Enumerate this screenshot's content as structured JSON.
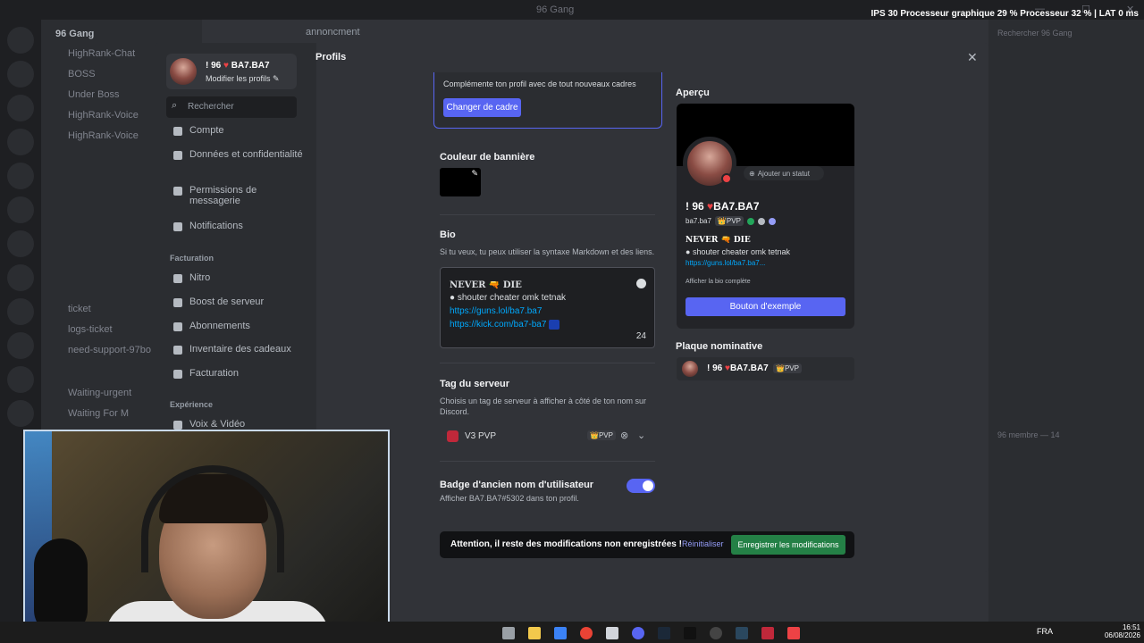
{
  "window": {
    "title": "96 Gang"
  },
  "hud": {
    "ips_label": "IPS",
    "ips_value": "30",
    "gpu_label": "Processeur graphique",
    "gpu_pct": "29 %",
    "cpu_label": "Processeur",
    "cpu_pct": "32 %",
    "lat_label": "LAT",
    "lat_value": "0 ms"
  },
  "bg": {
    "server_name": "96 Gang",
    "channel_header": "annoncment",
    "channels": [
      "HighRank-Chat",
      "BOSS",
      "Under Boss",
      "HighRank-Voice",
      "HighRank-Voice",
      "ticket",
      "logs-ticket",
      "need-support-97bo",
      "Waiting-urgent",
      "Waiting For M"
    ],
    "member_search": "Rechercher 96 Gang",
    "members_header": "96 membre — 14"
  },
  "modal": {
    "user_name": "! 96",
    "user_tag": "BA7.BA7",
    "modify_profiles": "Modifier les profils",
    "search_placeholder": "Rechercher",
    "nav": [
      {
        "label": "Compte"
      },
      {
        "label": "Données et confidentialité"
      },
      {
        "label": "Permissions de messagerie"
      },
      {
        "label": "Notifications"
      }
    ],
    "billing_header": "Facturation",
    "billing_nav": [
      {
        "label": "Nitro"
      },
      {
        "label": "Boost de serveur"
      },
      {
        "label": "Abonnements"
      },
      {
        "label": "Inventaire des cadeaux"
      },
      {
        "label": "Facturation"
      }
    ],
    "experience_header": "Expérience",
    "experience_nav": [
      {
        "label": "Voix & Vidéo"
      }
    ],
    "page_title": "Profils",
    "cadre": {
      "text": "Complémente ton profil avec de tout nouveaux cadres",
      "button": "Changer de cadre"
    },
    "banner": {
      "label": "Couleur de bannière",
      "color": "#000000"
    },
    "bio": {
      "label": "Bio",
      "hint": "Si tu veux, tu peux utiliser la syntaxe Markdown et des liens.",
      "line1": "NEVER 🔫 DIE",
      "line2": "shouter cheater omk tetnak",
      "link1": "https://guns.lol/ba7.ba7",
      "link2": "https://kick.com/ba7-ba7",
      "remaining": "24"
    },
    "server_tag": {
      "label": "Tag du serveur",
      "hint": "Choisis un tag de serveur à afficher à côté de ton nom sur Discord.",
      "selected": "V3 PVP",
      "badge": "PVP"
    },
    "old_name": {
      "label": "Badge d'ancien nom d'utilisateur",
      "hint": "Afficher BA7.BA7#5302 dans ton profil.",
      "enabled": true
    },
    "unsaved": {
      "text": "Attention, il reste des modifications non enregistrées !",
      "reset": "Réinitialiser",
      "save": "Enregistrer les modifications"
    },
    "preview": {
      "label": "Aperçu",
      "add_status": "Ajouter un statut",
      "display_name": "! 96",
      "display_name2": "BA7.BA7",
      "username": "ba7.ba7",
      "tag": "PVP",
      "bio_line1": "NEVER 🔫 DIE",
      "bio_line2": "shouter cheater omk tetnak",
      "bio_link": "https://guns.lol/ba7.ba7...",
      "show_full_bio": "Afficher la bio complète",
      "example_button": "Bouton d'exemple"
    },
    "plaque": {
      "label": "Plaque nominative",
      "name": "! 96",
      "name2": "BA7.BA7",
      "tag": "PVP"
    }
  },
  "taskbar": {
    "lang": "FRA",
    "time": "16:51",
    "date": "06/08/2026"
  },
  "colors": {
    "accent": "#5865f2",
    "save": "#248046",
    "link": "#00a8fc",
    "heart": "#ed4245"
  }
}
